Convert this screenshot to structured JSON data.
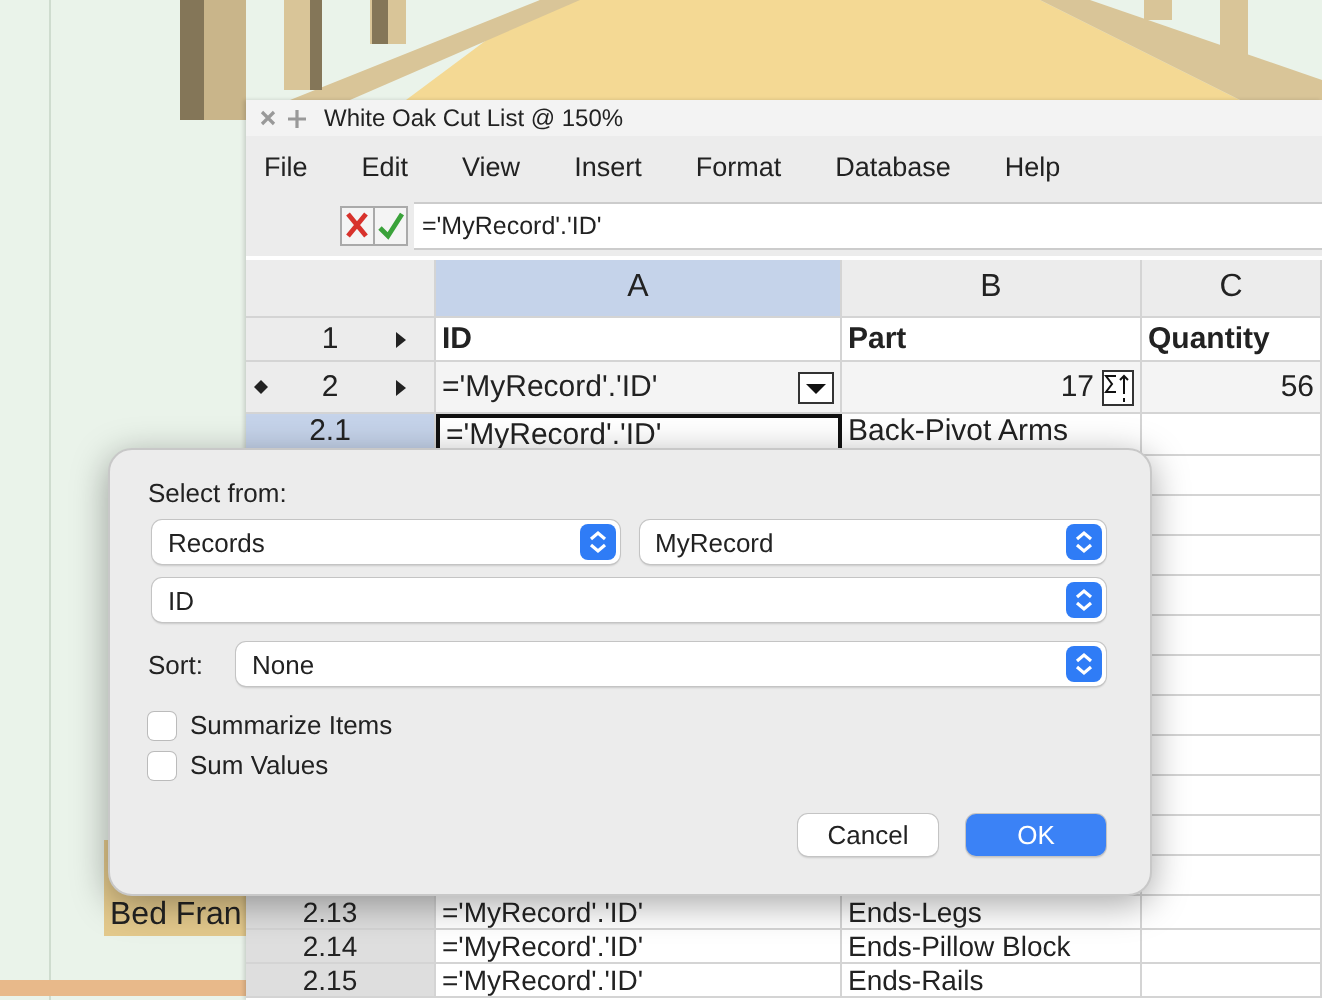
{
  "drawing_label": "Bed Fran",
  "window": {
    "title": "White Oak Cut List @ 150%"
  },
  "menu": [
    "File",
    "Edit",
    "View",
    "Insert",
    "Format",
    "Database",
    "Help"
  ],
  "formula_bar": {
    "value": "='MyRecord'.'ID'"
  },
  "columns": [
    {
      "label": "A",
      "selected": true
    },
    {
      "label": "B",
      "selected": false
    },
    {
      "label": "C",
      "selected": false
    }
  ],
  "rows": [
    {
      "kind": "titles",
      "header": "1",
      "marker": false,
      "expander": true,
      "selected": false,
      "cells": [
        "ID",
        "Part",
        "Quantity"
      ]
    },
    {
      "kind": "database",
      "header": "2",
      "marker": true,
      "expander": true,
      "selected": false,
      "cells": [
        "='MyRecord'.'ID'",
        "17",
        "56"
      ]
    },
    {
      "kind": "item",
      "header": "2.1",
      "marker": false,
      "expander": false,
      "selected": true,
      "cells": [
        "='MyRecord'.'ID'",
        "Back-Pivot Arms"
      ]
    },
    {
      "kind": "item",
      "header": "2.13",
      "marker": false,
      "expander": false,
      "selected": false,
      "cells": [
        "='MyRecord'.'ID'",
        "Ends-Legs"
      ]
    },
    {
      "kind": "item",
      "header": "2.14",
      "marker": false,
      "expander": false,
      "selected": false,
      "cells": [
        "='MyRecord'.'ID'",
        "Ends-Pillow Block"
      ]
    },
    {
      "kind": "item",
      "header": "2.15",
      "marker": false,
      "expander": false,
      "selected": false,
      "cells": [
        "='MyRecord'.'ID'",
        "Ends-Rails"
      ]
    }
  ],
  "dialog": {
    "select_label": "Select from:",
    "source_popups": [
      {
        "value": "Records"
      },
      {
        "value": "MyRecord"
      }
    ],
    "field_popup": {
      "value": "ID"
    },
    "sort_label": "Sort:",
    "sort_popup": {
      "value": "None"
    },
    "options": [
      {
        "label": "Summarize Items",
        "checked": false
      },
      {
        "label": "Sum Values",
        "checked": false
      }
    ],
    "buttons": [
      {
        "label": "Cancel",
        "default": false
      },
      {
        "label": "OK",
        "default": true
      }
    ]
  }
}
